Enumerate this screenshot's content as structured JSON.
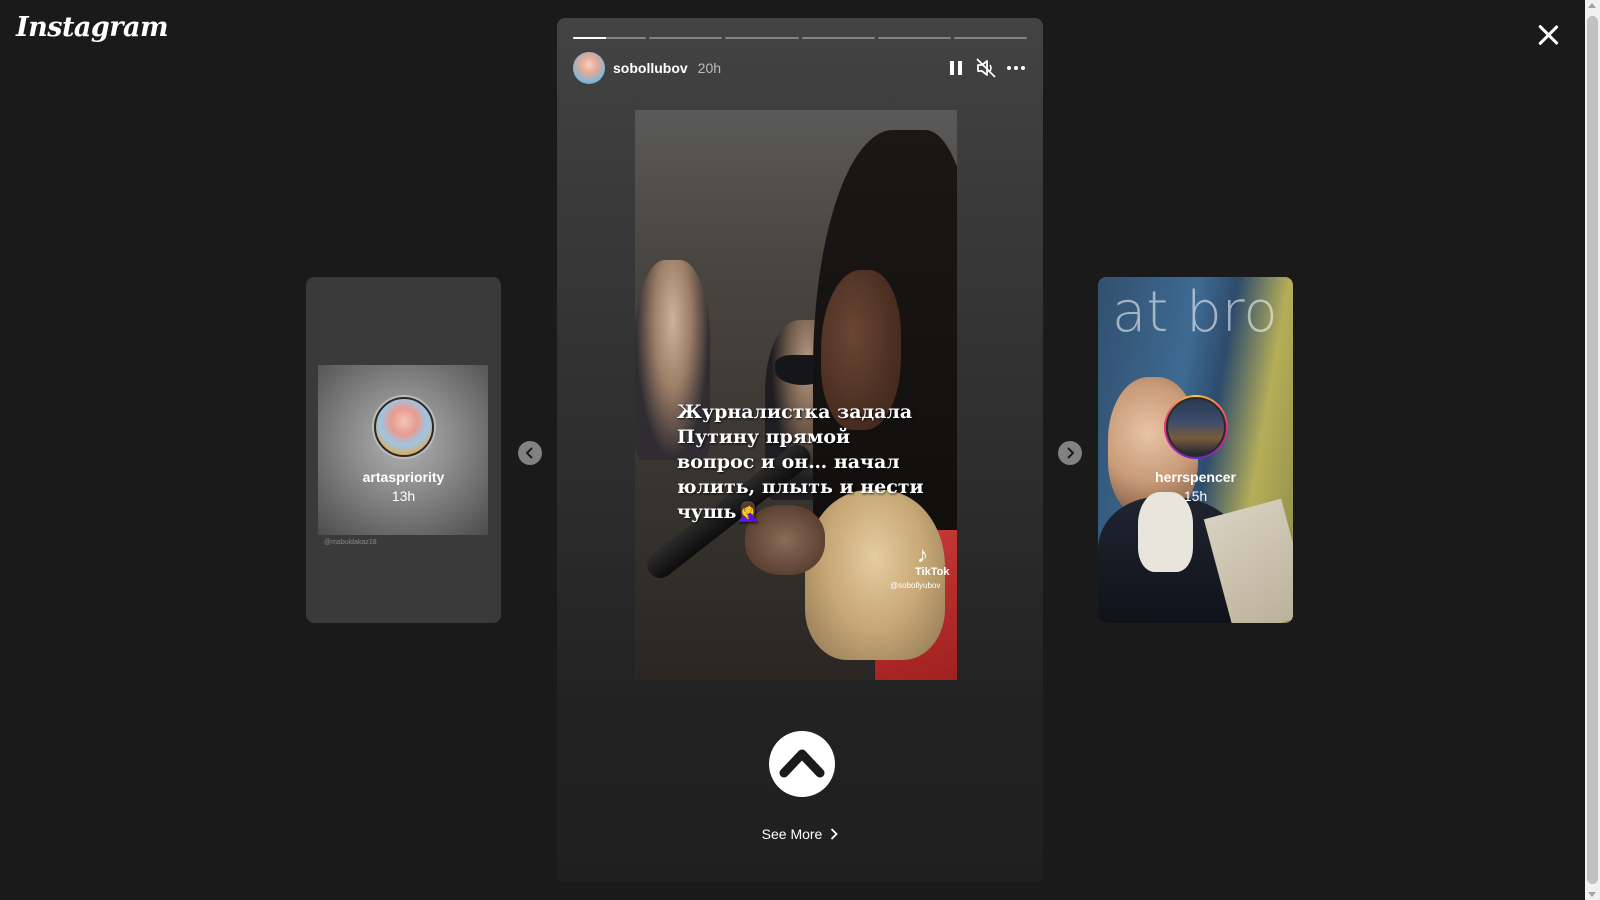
{
  "app": {
    "logo_text": "Instagram"
  },
  "story": {
    "username": "sobollubov",
    "time": "20h",
    "progress_segments": 6,
    "active_segment_progress": 0.45,
    "caption": "Журналистка задала Путину прямой вопрос и он… начал юлить, плыть и нести чушь🤦‍♀️",
    "watermark": {
      "logo": "♪",
      "name": "TikTok",
      "handle": "@sobollyubov"
    },
    "see_more": "See More",
    "icons": {
      "pause": "pause-icon",
      "mute": "muted-speaker-icon",
      "more": "more-options-icon"
    }
  },
  "previews": {
    "left": {
      "username": "artaspriority",
      "time": "13h",
      "credit": "@mabuldakaz18"
    },
    "right": {
      "username": "herrspencer",
      "time": "15h",
      "scribble": "at bro"
    }
  },
  "colors": {
    "background": "#1a1a1a",
    "text": "#ffffff",
    "accent_ring": "#ee2a7b"
  }
}
